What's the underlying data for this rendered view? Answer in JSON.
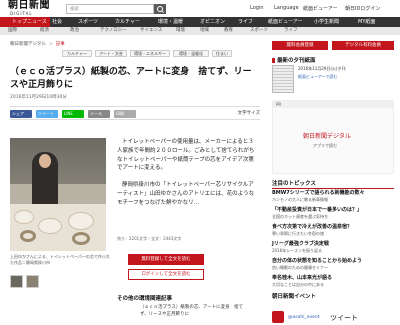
{
  "header": {
    "logo": "朝日新聞",
    "logo_sub": "DIGITAL",
    "search_placeholder": "検索",
    "links": [
      "Login",
      "Language",
      "紙面ビューアー",
      "朝日IDログイン"
    ]
  },
  "nav": {
    "items": [
      "トップニュース",
      "社会",
      "スポーツ",
      "カルチャー",
      "環境・温暖",
      "オピニオン",
      "ライフ",
      "紙面ビューアー",
      "小学生新聞",
      "MY紙面"
    ],
    "active_index": 0
  },
  "subnav": {
    "items": [
      "国際",
      "経済",
      "政治",
      "国際",
      "テクノロジー",
      "サイエンス",
      "環境",
      "地域",
      "国際",
      "教育",
      "スポーツ",
      "ライフ"
    ]
  },
  "breadcrumb": [
    "朝日新聞デジタル",
    "記事"
  ],
  "tags": [
    "カルチャー",
    "アート・文芸",
    "環境・エネルギー",
    "環境・温暖化",
    "住まい",
    "新しい時代",
    "収蔵品",
    "紙面"
  ],
  "article": {
    "title": "（ｅｃｏ活プラス）紙製の芯、アートに変身　捨てず、リースや正月飾りに",
    "date": "2016年11月29日16時30分",
    "font_size_label": "文字サイズ",
    "social": [
      "シェア",
      "ツイート",
      "LINE",
      "メール",
      "印刷"
    ],
    "photo_caption": "上田ゆかさんによる、トイレットペーパーの芯で作られた作品＝静岡県掛川市",
    "body": [
      "トイレットペーパーの使用量は、メーカーによると３人家族で年間約２００ロール。ごみとして捨てられがちなトイレットペーパーや紙筒テープの芯をアイデア次第でアートに変える。",
      "静岡県掛川市の「トイレットペーパー芯リサイクルアーティスト」山田ゆかさんのアトリエには、花のようなモチーフをつなげた鮮やかなリ…"
    ],
    "meta": "残り：2201文字／全文：2443文字",
    "btn_free": "無料登録して全文を読む",
    "btn_login": "ログインして全文を読む",
    "related_title": "その他の環境関連記事",
    "related_item": "（ｅｃｏ活プラス）紙製の芯、アートに変身　捨てず、リースや正月飾りに"
  },
  "right": {
    "btn_left": "無料会員登録",
    "btn_right": "デジタル有料会員",
    "paper_head": "最新の夕刊紙面",
    "paper_date": "2016年11月29日(火)夕刊",
    "paper_link": "紙面ビューアーで読む",
    "ad_text": [
      "PR",
      "朝日新聞デジタル",
      "アプリで読む"
    ],
    "rank_head": "注目のトピックス",
    "ranks": [
      {
        "title": "BMW7シリーズで語られる新機能の数々",
        "desc": "ホンモノの大人に贈る新車情報"
      },
      {
        "title": "「不動産投資が日本で一番多いのは？」",
        "desc": "全国のホット資産を選ぶ気持ち"
      },
      {
        "title": "食べ方次第で冷えが改善の温泉宿？",
        "desc": "寒い季節に行きたい冬宿の旅"
      },
      {
        "title": "Jリーグ最強クラブ決定戦",
        "desc": "2016年シーズンを振り返る"
      },
      {
        "title": "自分の体の状態を知ることから始めよう",
        "desc": "良い睡眠のための健康セミナー"
      },
      {
        "title": "奉名桂木、山本来光が語る",
        "desc": "大切なことは自分の中にある"
      }
    ],
    "event_head": "朝日新聞イベント",
    "tweet_handle": "@asahi_event",
    "tweet_word": "ツイート"
  },
  "colors": {
    "brand_red": "#c2161c",
    "nav_bg": "#333333"
  }
}
